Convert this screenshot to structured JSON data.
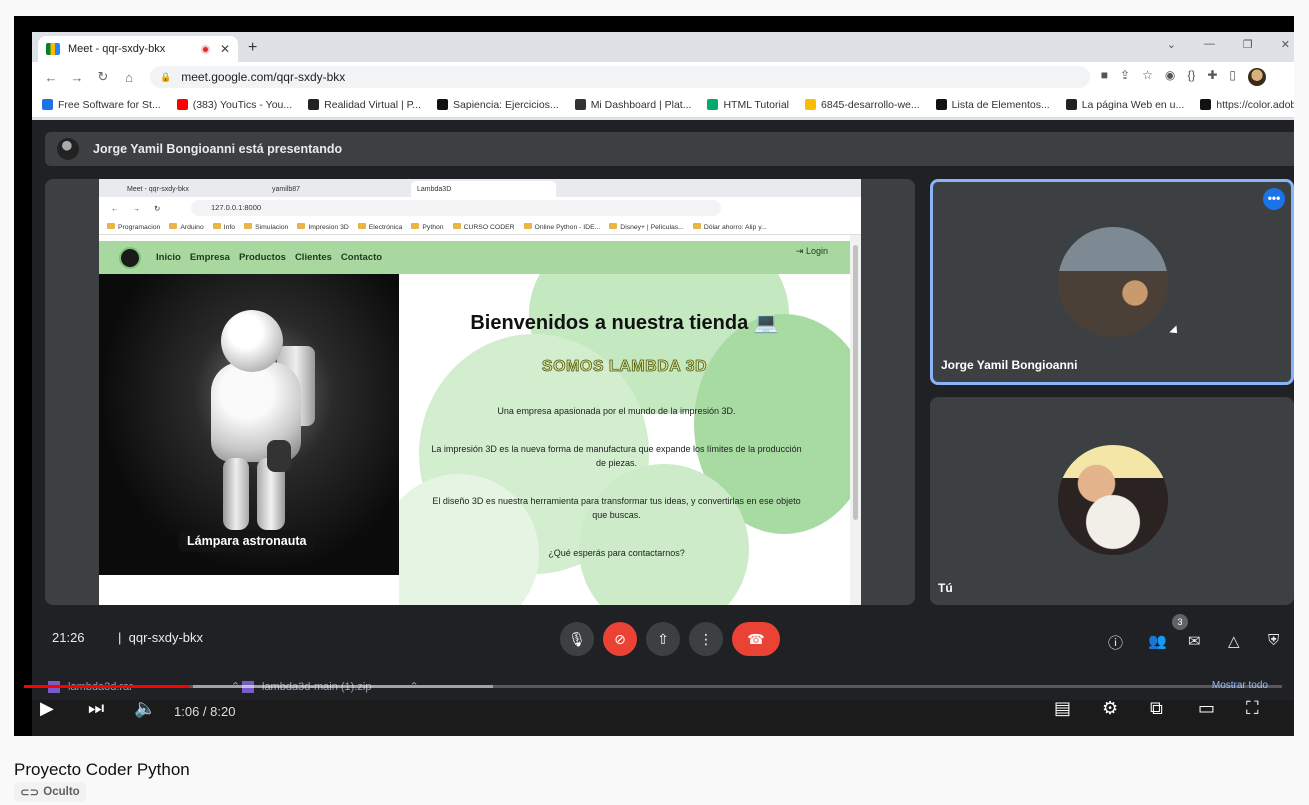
{
  "browser": {
    "tab_title": "Meet - qqr-sxdy-bkx",
    "tab_close": "✕",
    "new_tab": "+",
    "url": "meet.google.com/qqr-sxdy-bkx",
    "bookmarks": [
      {
        "label": "Free Software for St...",
        "color": "#1a73e8"
      },
      {
        "label": "(383) YouTics - You...",
        "color": "#ff0000"
      },
      {
        "label": "Realidad Virtual | P...",
        "color": "#222222"
      },
      {
        "label": "Sapiencia: Ejercicios...",
        "color": "#111111"
      },
      {
        "label": "Mi Dashboard | Plat...",
        "color": "#333333"
      },
      {
        "label": "HTML Tutorial",
        "color": "#04aa6d"
      },
      {
        "label": "6845-desarrollo-we...",
        "color": "#fbbc04"
      },
      {
        "label": "Lista de Elementos...",
        "color": "#111111"
      },
      {
        "label": "La página Web en u...",
        "color": "#222222"
      },
      {
        "label": "https://color.adobe....",
        "color": "#111111"
      }
    ]
  },
  "meet": {
    "presenting_text": "Jorge Yamil Bongioanni está presentando",
    "participants": [
      {
        "name": "Jorge Yamil Bongioanni"
      },
      {
        "name": "Tú"
      }
    ],
    "time": "21:26",
    "meeting_code": "qqr-sxdy-bkx",
    "people_count": "3"
  },
  "shared_screen": {
    "tabs": [
      "Meet - qqr-sxdy-bkx",
      "yamilb87",
      "Lambda3D"
    ],
    "url": "127.0.0.1:8000",
    "favorites": [
      "Programacion",
      "Arduino",
      "Info",
      "Simulacion",
      "Impresion 3D",
      "Electrónica",
      "Python",
      "CURSO CODER",
      "Online Python - IDE...",
      "Disney+ | Películas...",
      "Dólar ahorro: Alip y..."
    ],
    "site": {
      "nav": [
        "Inicio",
        "Empresa",
        "Productos",
        "Clientes",
        "Contacto"
      ],
      "login": "Login",
      "image_caption": "Lámpara astronauta",
      "heading": "Bienvenidos a nuestra tienda 💻",
      "subheading": "SOMOS LAMBDA 3D",
      "paragraphs": [
        "Una empresa apasionada por el mundo de la impresión 3D.",
        "La impresión 3D es la nueva forma de manufactura que expande los límites de la producción de piezas.",
        "El diseño 3D es nuestra herramienta para transformar tus ideas, y convertirlas en ese objeto que buscas.",
        "¿Qué esperás para contactarnos?"
      ]
    }
  },
  "downloads": [
    {
      "name": "lambda3d.rar"
    },
    {
      "name": "lambda3d-main (1).zip"
    }
  ],
  "downloads_show_all": "Mostrar todo",
  "player": {
    "time_current": "1:06",
    "time_sep": " / ",
    "time_total": "8:20",
    "progress_fraction": 0.132
  },
  "video": {
    "title": "Proyecto Coder Python",
    "visibility": "Oculto"
  },
  "colors": {
    "accent_blue": "#8ab4f8",
    "hangup_red": "#ea4335",
    "site_nav_green": "#a8d8a0",
    "progress_red": "#ff0000"
  }
}
